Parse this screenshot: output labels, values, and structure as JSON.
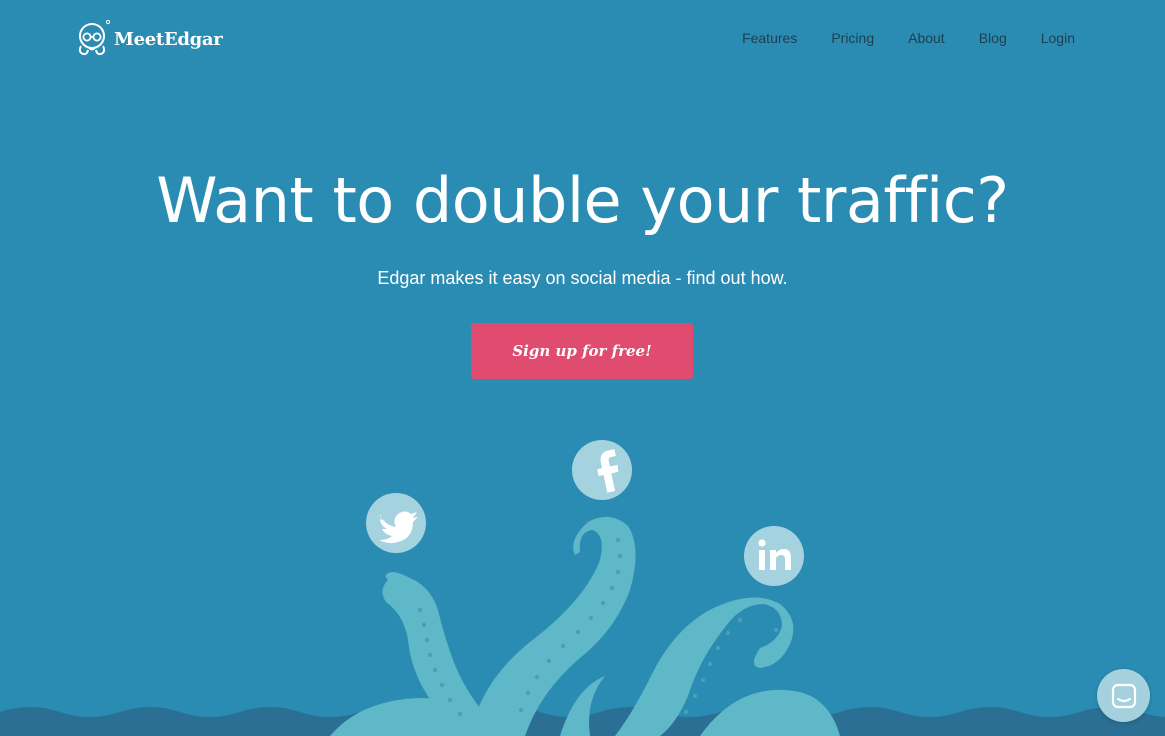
{
  "brand": {
    "name": "MeetEdgar"
  },
  "nav": {
    "items": [
      {
        "label": "Features"
      },
      {
        "label": "Pricing"
      },
      {
        "label": "About"
      },
      {
        "label": "Blog"
      },
      {
        "label": "Login"
      }
    ]
  },
  "hero": {
    "title": "Want to double your traffic?",
    "subtitle": "Edgar makes it easy on social media - find out how.",
    "cta_label": "Sign up for free!"
  },
  "illustration": {
    "icons": [
      "twitter-icon",
      "facebook-icon",
      "linkedin-icon"
    ]
  },
  "chat": {
    "icon": "chat-icon"
  },
  "colors": {
    "background": "#2a8cb3",
    "cta": "#e04c70",
    "tentacle": "#5fb8c7",
    "sea": "#2b6f95",
    "social_badge": "#a5d2df",
    "nav_text": "#1e3f4e"
  }
}
